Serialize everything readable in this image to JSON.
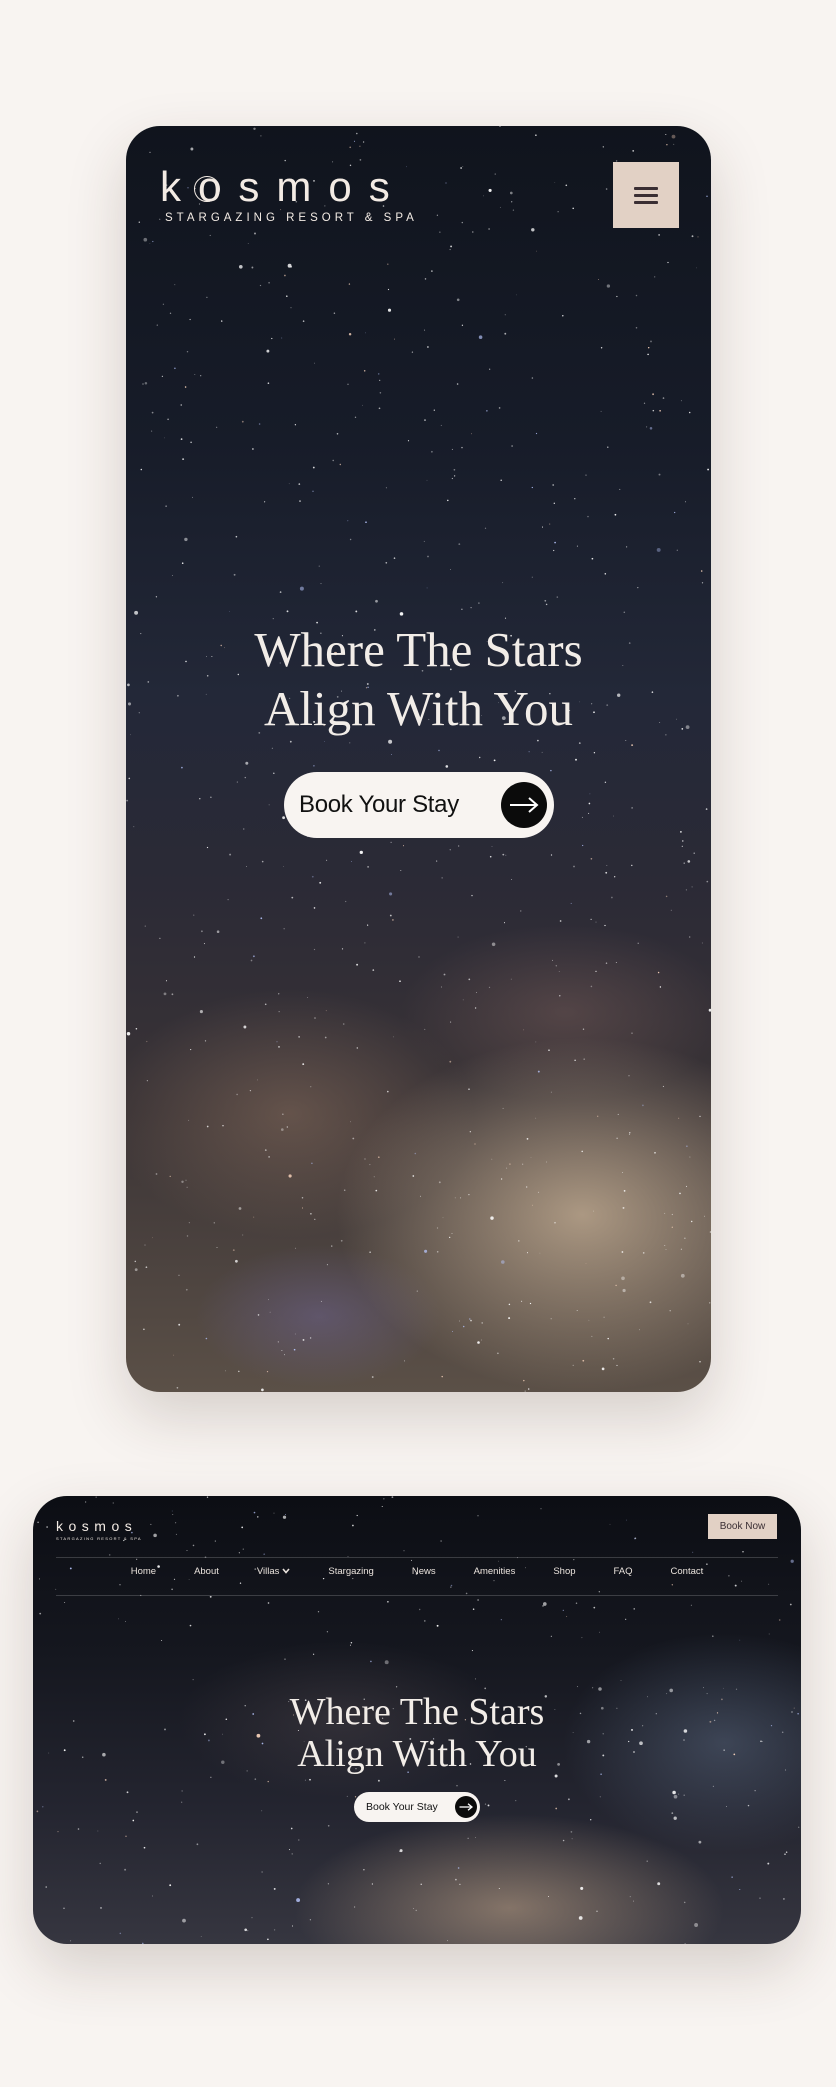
{
  "brand": {
    "name": "kosmos",
    "tagline": "STARGAZING RESORT & SPA"
  },
  "mobile": {
    "menu_icon": "hamburger-icon",
    "hero_line1": "Where The Stars",
    "hero_line2": "Align With You",
    "cta_label": "Book Your Stay",
    "cta_icon": "arrow-right-icon"
  },
  "desktop": {
    "book_button": "Book Now",
    "nav": [
      {
        "label": "Home"
      },
      {
        "label": "About"
      },
      {
        "label": "Villas",
        "icon": "chevron-down-icon"
      },
      {
        "label": "Stargazing"
      },
      {
        "label": "News"
      },
      {
        "label": "Amenities"
      },
      {
        "label": "Shop"
      },
      {
        "label": "FAQ"
      },
      {
        "label": "Contact"
      }
    ],
    "hero_line1": "Where The Stars",
    "hero_line2": "Align With You",
    "cta_label": "Book Your Stay",
    "cta_icon": "arrow-right-icon"
  },
  "colors": {
    "page_background": "#f8f4f1",
    "menu_button": "#e2d1c5",
    "cta_background": "#f8f4f1",
    "cta_arrow": "#0b0b0b",
    "hero_text": "#f2ede8"
  }
}
